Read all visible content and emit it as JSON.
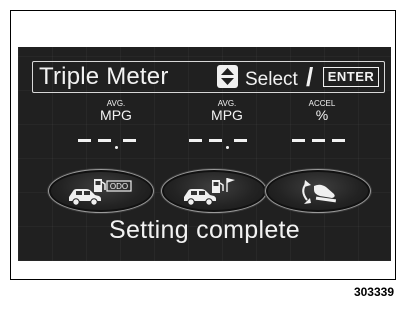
{
  "header": {
    "title": "Triple Meter",
    "select_label": "Select",
    "separator": "/",
    "enter_label": "ENTER"
  },
  "meters": [
    {
      "label_small": "AVG.",
      "label_large": "MPG",
      "value": "- - . -"
    },
    {
      "label_small": "AVG.",
      "label_large": "MPG",
      "value": "- - . -"
    },
    {
      "label_small": "ACCEL",
      "label_large": "%",
      "value": "- - -"
    }
  ],
  "buttons": [
    {
      "icon": "car-fuel-odo-icon",
      "text": "ODO"
    },
    {
      "icon": "car-fuel-flag-icon"
    },
    {
      "icon": "accelerator-pedal-icon"
    }
  ],
  "status": "Setting complete",
  "figure_code": "303339",
  "colors": {
    "screen_bg": "#202020",
    "text": "#f2f2f2"
  }
}
